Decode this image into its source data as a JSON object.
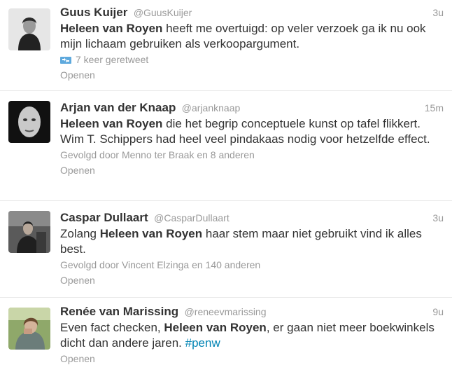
{
  "tweets": [
    {
      "name": "Guus Kuijer",
      "handle": "@GuusKuijer",
      "time": "3u",
      "mention": "Heleen van Royen",
      "text_before": "",
      "text_after": " heeft me overtuigd: op veler verzoek ga ik nu ook mijn lichaam gebruiken als verkoopargument.",
      "meta": "7 keer geretweet",
      "meta_icon": "retweet-icon",
      "open": "Openen"
    },
    {
      "name": "Arjan van der Knaap",
      "handle": "@arjanknaap",
      "time": "15m",
      "mention": "Heleen van Royen",
      "text_before": "",
      "text_after": " die het begrip conceptuele kunst op tafel flikkert. Wim T. Schippers had heel veel pindakaas nodig voor hetzelfde effect.",
      "meta": "Gevolgd door Menno ter Braak en 8 anderen",
      "open": "Openen"
    },
    {
      "name": "Caspar Dullaart",
      "handle": "@CasparDullaart",
      "time": "3u",
      "mention": "Heleen van Royen",
      "text_before": "Zolang ",
      "text_after": " haar stem maar niet gebruikt vind ik alles best.",
      "meta": "Gevolgd door Vincent Elzinga en 140 anderen",
      "open": "Openen"
    },
    {
      "name": "Renée van Marissing",
      "handle": "@reneevmarissing",
      "time": "9u",
      "mention": "Heleen van Royen",
      "text_before": "Even fact checken, ",
      "text_after": ", er gaan niet meer boekwinkels dicht dan andere jaren.",
      "hashtag": "#penw",
      "open": "Openen"
    }
  ],
  "colors": {
    "name": "#333333",
    "muted": "#999999",
    "link": "#0084b4",
    "divider": "#e8e8e8",
    "retweet_icon": "#5ea9dd"
  }
}
